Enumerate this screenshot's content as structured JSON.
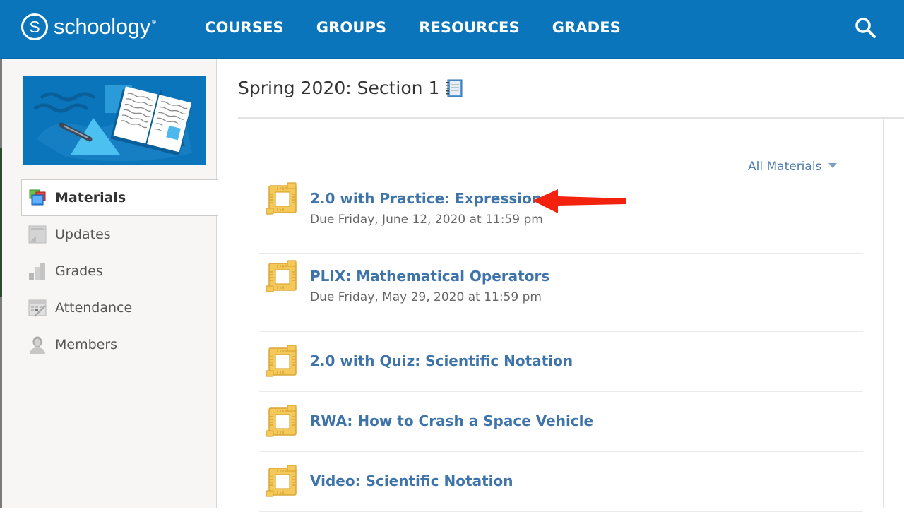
{
  "header": {
    "logo_text": "schoology",
    "logo_mark": "S",
    "logo_reg": "®",
    "nav": [
      {
        "label": "COURSES"
      },
      {
        "label": "GROUPS"
      },
      {
        "label": "RESOURCES"
      },
      {
        "label": "GRADES"
      }
    ],
    "search_icon": "search-icon"
  },
  "sidebar": {
    "banner_icon": "course-banner-illustration",
    "items": [
      {
        "label": "Materials",
        "icon": "materials-icon",
        "active": true
      },
      {
        "label": "Updates",
        "icon": "updates-icon",
        "active": false
      },
      {
        "label": "Grades",
        "icon": "grades-icon",
        "active": false
      },
      {
        "label": "Attendance",
        "icon": "attendance-icon",
        "active": false
      },
      {
        "label": "Members",
        "icon": "members-icon",
        "active": false
      }
    ]
  },
  "main": {
    "title": "Spring 2020: Section 1",
    "title_icon": "notebook-icon",
    "filter": {
      "label": "All Materials",
      "icon": "caret-down-icon"
    },
    "materials": [
      {
        "title": "2.0 with Practice: Expressions",
        "due": "Due Friday, June 12, 2020 at 11:59 pm",
        "icon": "assignment-ruler-icon"
      },
      {
        "title": "PLIX: Mathematical Operators",
        "due": "Due Friday, May 29, 2020 at 11:59 pm",
        "icon": "assignment-ruler-icon"
      },
      {
        "title": "2.0 with Quiz: Scientific Notation",
        "due": null,
        "icon": "assignment-ruler-icon"
      },
      {
        "title": "RWA: How to Crash a Space Vehicle",
        "due": null,
        "icon": "assignment-ruler-icon"
      },
      {
        "title": "Video: Scientific Notation",
        "due": null,
        "icon": "assignment-ruler-icon"
      }
    ]
  },
  "annotation": {
    "type": "arrow",
    "color": "#f2220e",
    "points_to": "2.0 with Practice: Expressions"
  },
  "colors": {
    "brand": "#0b75bb",
    "link": "#3f74ab",
    "annotation_arrow": "#f2220e"
  }
}
